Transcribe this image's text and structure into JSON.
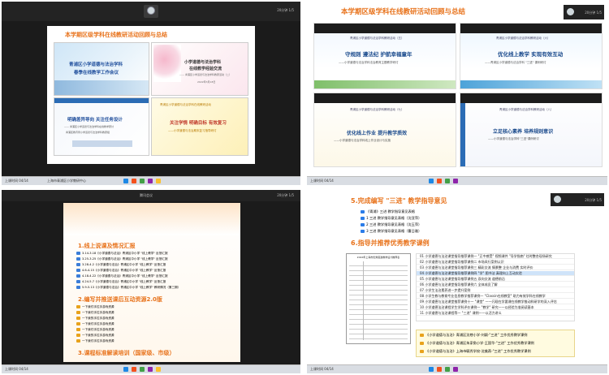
{
  "q1": {
    "topbar": {
      "left": "",
      "right": "20分钟 1/5"
    },
    "title": "本学期区级学科在线教研活动回顾与总结",
    "card_tl": {
      "line1": "青浦区小学道德与法治学科",
      "line2": "春季在线教学工作会议"
    },
    "card_tr": {
      "line1": "小学道德与法治学科",
      "line2": "在线教学经验交流",
      "sub": "—— 青浦区小学道德与法治学科教研活动（二）",
      "date": "2022年3月18日"
    },
    "card_bl": {
      "line1": "明确差异导向  关注任务设计",
      "sub1": "—— 青浦区小学道德与法治学科在线教学研讨",
      "sub2": "青浦区教育局小学道德与法治学科教研组"
    },
    "card_br": {
      "head": "青浦区小学道德与法治学科在线教研活动",
      "line1": "关注学情  明确目标  有效复习",
      "sub": "——小学道德与法治期末复习指导研讨"
    },
    "taskbar": {
      "start": "上课时间 04/14",
      "item": "上海市青浦区小学教研中心"
    }
  },
  "q2": {
    "topbar": {
      "right": "20分钟 1/5"
    },
    "title": "本学期区级学科在线教研活动回顾与总结",
    "card1": {
      "head": "青浦区小学道德与法治学科教研活动（五）",
      "line1": "守规则  遵法纪  护航幸福童年",
      "sub": "——小学道德与法治学科法治教育主题教学研讨"
    },
    "card2": {
      "head": "青浦区小学道德与法治学科教研活动（六）",
      "line1": "优化线上教学  实现有效互动",
      "sub": "——青浦区小学道德与法治学科 \"三进\" 课例研讨"
    },
    "card3": {
      "head": "青浦区小学道德与法治学科教研活动（七）",
      "line1": "优化线上作业  提升教学质效",
      "sub": "——小学道德与法治学科线上作业设计与实施"
    },
    "card4": {
      "head": "青浦区小学道德与法治学科教研活动（八）",
      "line1": "立足核心素养  培养规则意识",
      "sub": "——小学道德与法治学科\"三进\"课例研讨"
    },
    "taskbar": {
      "start": "上课时间 04/14"
    }
  },
  "q3": {
    "topbar": {
      "left": "腾讯会议",
      "right": "20分钟 1/5"
    },
    "sec1": "1.线上说课及情况汇报",
    "items1": [
      "3.14-3.18《小学道德与法治》青浦区中小学 \"线上教学\" 反馈汇报",
      "3.25-3.25《小学道德与法治》青浦区中小学 \"线上教学\" 反馈汇报",
      "3.28-4.2《小学道德与法治》青浦区中小学 \"线上教学\" 反馈汇报",
      "4.6-4.15《小学道德与法治》青浦区中小学 \"线上教学\" 反馈汇报",
      "4.18-4.22《小学道德与法治》青浦区中小学 \"线上教学\" 反馈汇报",
      "4.24-5.7《小学道德与法治》青浦区中小学 \"线上教学\" 反馈汇报",
      "5.9-5.13《小学道德与法治》青浦区中小学 \"线上教学\" 教研情况（第三期）"
    ],
    "sec2": "2.编写并推送课后互动资源2.0版",
    "items2": [
      "一下我们手拉手游戏资源",
      "一下我们手拉手游戏资源",
      "一下我的手拉手游戏资源",
      "一下我们手拉手游戏资源",
      "一下我们手拉手游戏资源",
      "一下我的手拉手游戏资源",
      "一下我们手拉手游戏资源"
    ],
    "sec3": "3.课程标准解读培训（国家级、市级）",
    "taskbar": {
      "start": "上课时间 04/14"
    }
  },
  "q4": {
    "topbar": {
      "right": "20分钟 1/5"
    },
    "sec5": "5.完成编写 \"三进\" 教学指导意见",
    "items5": [
      "《青浦》三进 教学指导意见表格",
      "1 三进 教学指导意见表格（沈亚萍）",
      "2 三进 教学指导意见表格（沈玉萍）",
      "3 三进 教学指导意见表格（曹日雅）"
    ],
    "sec6": "6.指导并推荐优秀教学课例",
    "doc_title": "2022年上海市优秀思政教学设计推荐表",
    "rows": [
      "01 小学道德与法治课堂指导推荐课例一 \"正中感受\" 视频课件 \"导学指南\" 往时整合现场研究",
      "02 小学道德与法治课堂指导推荐课例二 市场风行案例认识",
      "03 小学道德与法治课堂指导推荐课例三 精彩交流 情景整 企业与消费 实时评价",
      "04 小学道德与法治课堂指导推荐课例四 \"学\" 图书法 真理向上互动实验",
      "05 小学道德与法治课堂指导推荐课例五 双向交流 道德前沿",
      "06 小学道德与法治课堂指导推荐课例六 全体成员了解",
      "07 小学生法治素养进一步提升案例",
      "08 小学生教与教育专业信息教学推荐课例一 \"Classin在线教室\" 助力有效学科在线教学",
      "09 小学道德与法治课堂推荐课例十一 \"课堂\" 一一闪现在学要课在线教学推动科研学的深入评估",
      "10 小学道德法治课程学生学科评价课例一 \"教学\" 研究一一以经验为准阅读基本",
      "11 小学道德与法治课程等一 \"三进\" 课例——以活力讲义"
    ],
    "links": [
      "《小学道德与法治》青浦区沈巷小学-刘颖-\"三进\" 工作优秀教学课例",
      "《小学道德与法治》青浦区朱家角小学-王国华-\"三进\" 工作优秀教学课例",
      "《小学道德与法治》上海市毓秀学校-沈美燕-\"三进\" 工作优秀教学课例"
    ],
    "taskbar": {
      "start": "上课时间 04/14"
    }
  },
  "colors": {
    "orange": "#e8731c",
    "dark": "#1b1b1b",
    "blue": "#1f4e9c"
  }
}
